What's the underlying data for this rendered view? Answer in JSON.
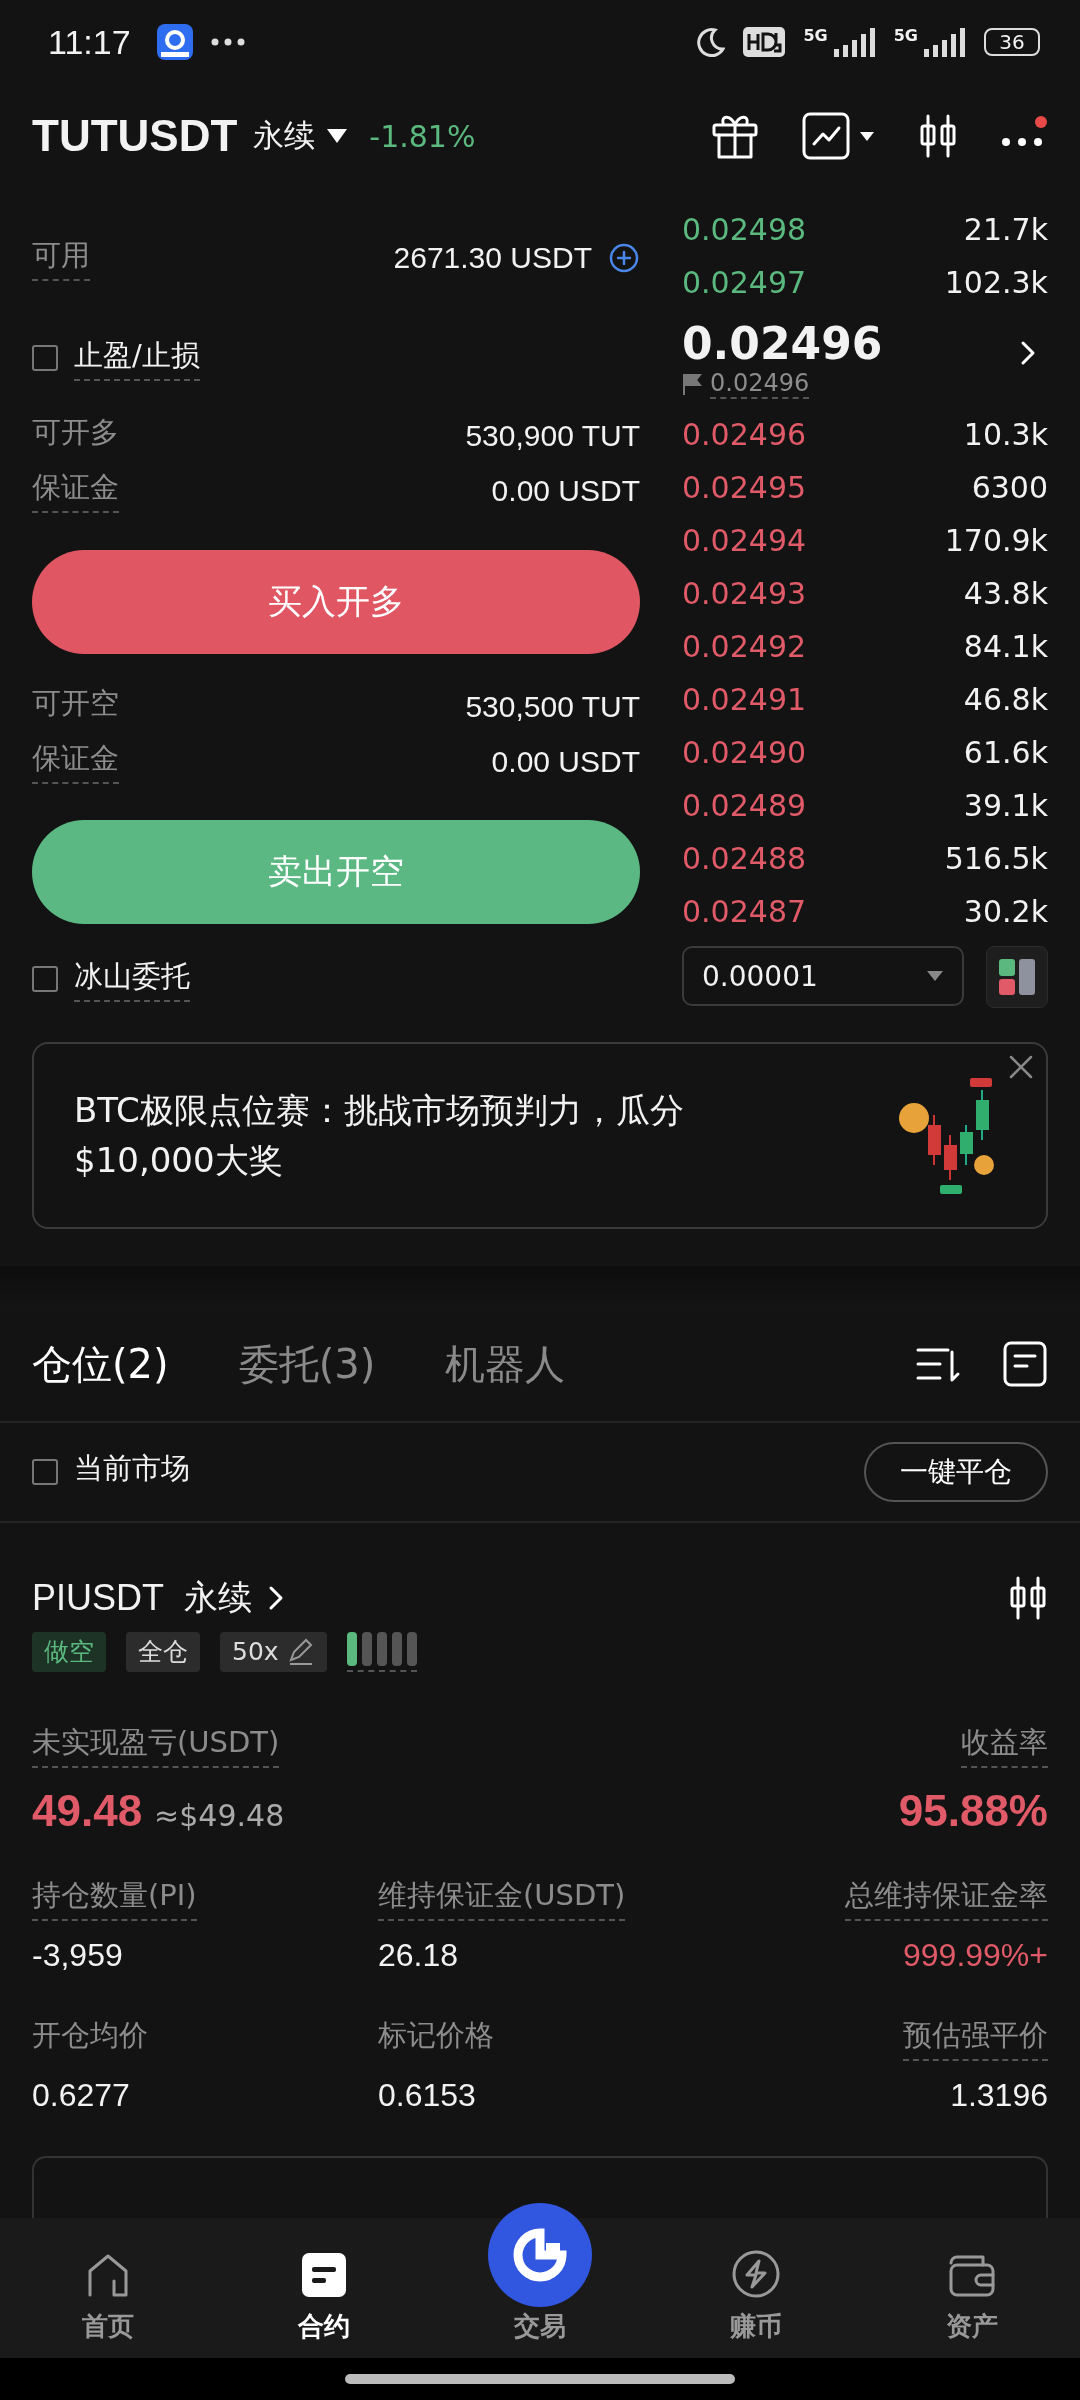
{
  "status_bar": {
    "time": "11:17",
    "network_1": "5G",
    "network_2": "5G",
    "battery": "36"
  },
  "header": {
    "symbol": "TUTUSDT",
    "contract": "永续",
    "change": "-1.81%"
  },
  "order_form": {
    "available_label": "可用",
    "available_value": "2671.30 USDT",
    "tpsl": {
      "label": "止盈/止损",
      "checked": false
    },
    "long": [
      {
        "label": "可开多",
        "value": "530,900 TUT",
        "underlined": false
      },
      {
        "label": "保证金",
        "value": "0.00 USDT",
        "underlined": true
      }
    ],
    "buy_button": "买入开多",
    "short": [
      {
        "label": "可开空",
        "value": "530,500 TUT",
        "underlined": false
      },
      {
        "label": "保证金",
        "value": "0.00 USDT",
        "underlined": true
      }
    ],
    "sell_button": "卖出开空",
    "iceberg": {
      "label": "冰山委托",
      "checked": false
    }
  },
  "order_book": {
    "upper": [
      {
        "price": "0.02498",
        "amount": "21.7k",
        "color": "#5bb97f"
      },
      {
        "price": "0.02497",
        "amount": "102.3k",
        "color": "#5bb97f"
      }
    ],
    "last_price": "0.02496",
    "mark_price": "0.02496",
    "lower": [
      {
        "price": "0.02496",
        "amount": "10.3k",
        "color": "#e05a68"
      },
      {
        "price": "0.02495",
        "amount": "6300",
        "color": "#e05a68"
      },
      {
        "price": "0.02494",
        "amount": "170.9k",
        "color": "#e05a68"
      },
      {
        "price": "0.02493",
        "amount": "43.8k",
        "color": "#e05a68"
      },
      {
        "price": "0.02492",
        "amount": "84.1k",
        "color": "#e05a68"
      },
      {
        "price": "0.02491",
        "amount": "46.8k",
        "color": "#e05a68"
      },
      {
        "price": "0.02490",
        "amount": "61.6k",
        "color": "#e05a68"
      },
      {
        "price": "0.02489",
        "amount": "39.1k",
        "color": "#e05a68"
      },
      {
        "price": "0.02488",
        "amount": "516.5k",
        "color": "#e05a68"
      },
      {
        "price": "0.02487",
        "amount": "30.2k",
        "color": "#e05a68"
      }
    ],
    "step": "0.00001"
  },
  "banner": {
    "text": "BTC极限点位赛：挑战市场预判力，瓜分$10,000大奖"
  },
  "tabs": [
    {
      "label": "仓位(2)",
      "selected": true
    },
    {
      "label": "委托(3)",
      "selected": false
    },
    {
      "label": "机器人",
      "selected": false
    }
  ],
  "filter": {
    "label": "当前市场",
    "checked": false
  },
  "close_all_button": "一键平仓",
  "position": {
    "symbol": "PIUSDT",
    "contract": "永续",
    "tags": [
      {
        "label": "做空",
        "kind": "side"
      },
      {
        "label": "全仓",
        "kind": "plain"
      },
      {
        "label": "50x",
        "kind": "edit"
      }
    ],
    "risk": {
      "level": 0.2
    },
    "pnl_label": "未实现盈亏(USDT)",
    "pnl_value": "49.48",
    "pnl_approx": "≈$49.48",
    "roe_label": "收益率",
    "roe_value": "95.88%",
    "metrics": [
      {
        "label": "持仓数量(PI)",
        "value": "-3,959",
        "underlined": true,
        "red": false
      },
      {
        "label": "维持保证金(USDT)",
        "value": "26.18",
        "underlined": true,
        "red": false
      },
      {
        "label": "总维持保证金率",
        "value": "999.99%+",
        "underlined": true,
        "red": true
      },
      {
        "label": "开仓均价",
        "value": "0.6277",
        "underlined": false,
        "red": false
      },
      {
        "label": "标记价格",
        "value": "0.6153",
        "underlined": false,
        "red": false
      },
      {
        "label": "预估强平价",
        "value": "1.3196",
        "underlined": true,
        "red": false
      }
    ]
  },
  "nav": [
    {
      "label": "首页",
      "selected": false
    },
    {
      "label": "合约",
      "selected": true
    },
    {
      "label": "交易",
      "selected": false
    },
    {
      "label": "赚币",
      "selected": false
    },
    {
      "label": "资产",
      "selected": false
    }
  ]
}
